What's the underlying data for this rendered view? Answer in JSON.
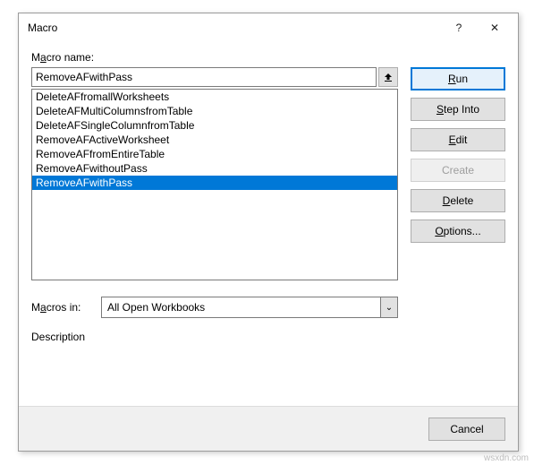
{
  "titlebar": {
    "title": "Macro",
    "help": "?",
    "close": "✕"
  },
  "labels": {
    "macroName_pre": "M",
    "macroName_u": "a",
    "macroName_post": "cro name:",
    "macrosIn_pre": "M",
    "macrosIn_u": "a",
    "macrosIn_post": "cros in:",
    "description": "Description"
  },
  "macroName": {
    "value": "RemoveAFwithPass"
  },
  "list": {
    "items": [
      "DeleteAFfromallWorksheets",
      "DeleteAFMultiColumnsfromTable",
      "DeleteAFSingleColumnfromTable",
      "RemoveAFActiveWorksheet",
      "RemoveAFfromEntireTable",
      "RemoveAFwithoutPass",
      "RemoveAFwithPass"
    ],
    "selectedIndex": 6
  },
  "macrosIn": {
    "value": "All Open Workbooks"
  },
  "buttons": {
    "run_u": "R",
    "run_post": "un",
    "step_u": "S",
    "step_post": "tep Into",
    "edit_u": "E",
    "edit_post": "dit",
    "create_u": "C",
    "create_post": "reate",
    "delete_u": "D",
    "delete_post": "elete",
    "options_u": "O",
    "options_post": "ptions...",
    "cancel": "Cancel"
  },
  "watermark": "wsxdn.com"
}
